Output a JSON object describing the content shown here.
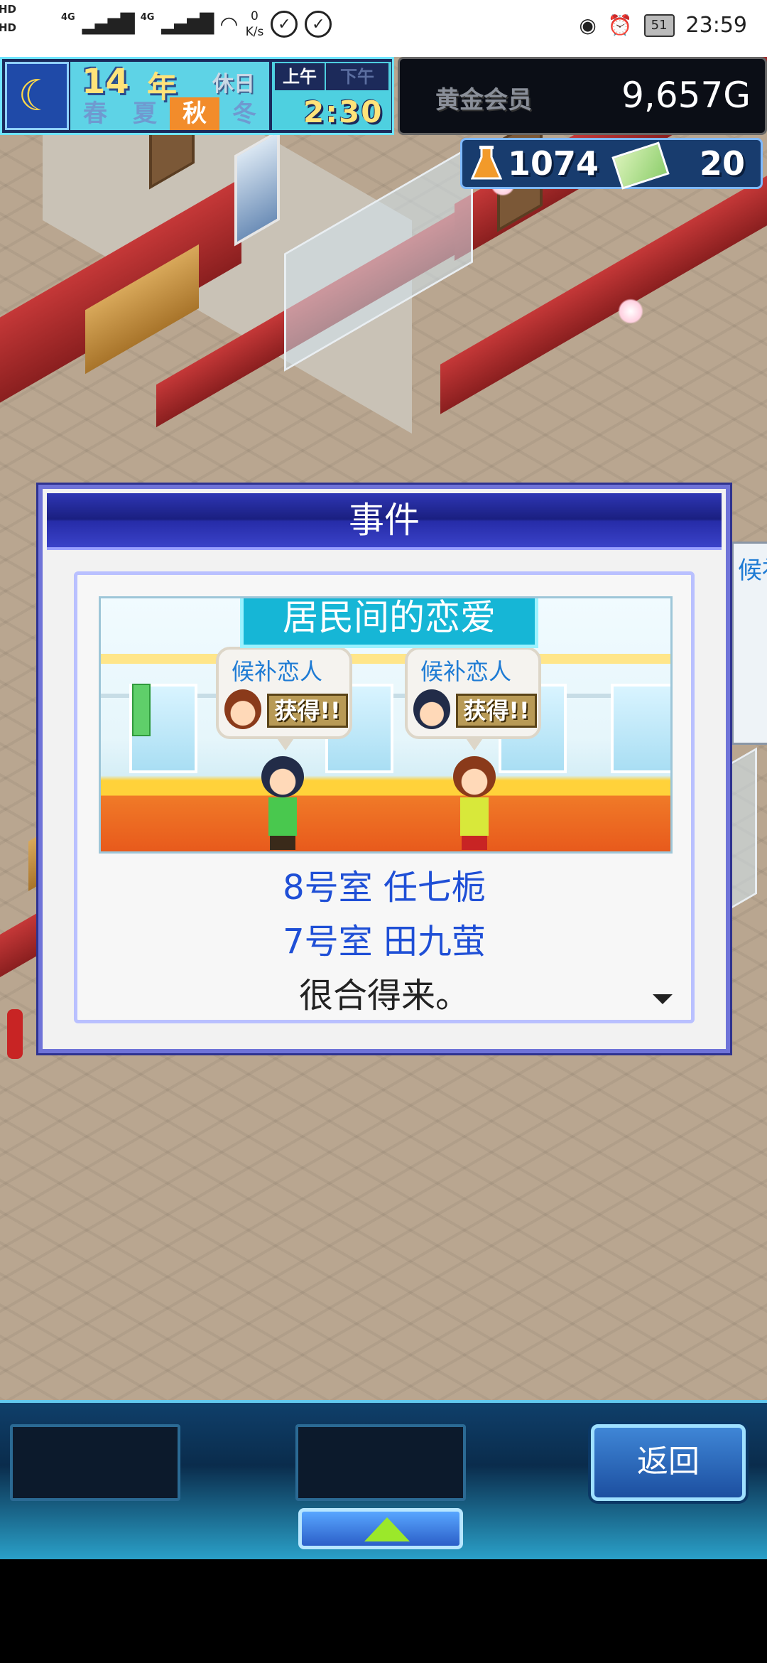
{
  "status_bar": {
    "hd1": "HD",
    "hd2": "HD",
    "net1": "4G",
    "net2": "4G",
    "speed_value": "0",
    "speed_unit": "K/s",
    "battery": "51",
    "time": "23:59"
  },
  "hud": {
    "year_number": "14",
    "year_unit": "年",
    "day_type": "休日",
    "seasons": [
      "春",
      "夏",
      "秋",
      "冬"
    ],
    "active_season": "秋",
    "am_label": "上午",
    "pm_label": "下午",
    "clock": "2:30",
    "member_label": "黄金会员",
    "gold": "9,657G",
    "research_points": "1074",
    "tickets": "20"
  },
  "dialog": {
    "title": "事件",
    "banner": "居民间的恋爱",
    "bubble_label": "候补恋人",
    "gain_label": "获得!!",
    "line1": "8号室 任七栀",
    "line2": "7号室 田九萤",
    "line3": "很合得来。"
  },
  "side_card": {
    "label": "候补"
  },
  "bottom": {
    "back_label": "返回"
  },
  "colors": {
    "dialog_title_bg": "#1a1f80",
    "banner_bg": "#16b6d6",
    "name_text": "#1f4fd6",
    "bubble_label": "#1e7bd4",
    "active_season": "#f28c2b",
    "clock_text": "#ffe37a"
  }
}
